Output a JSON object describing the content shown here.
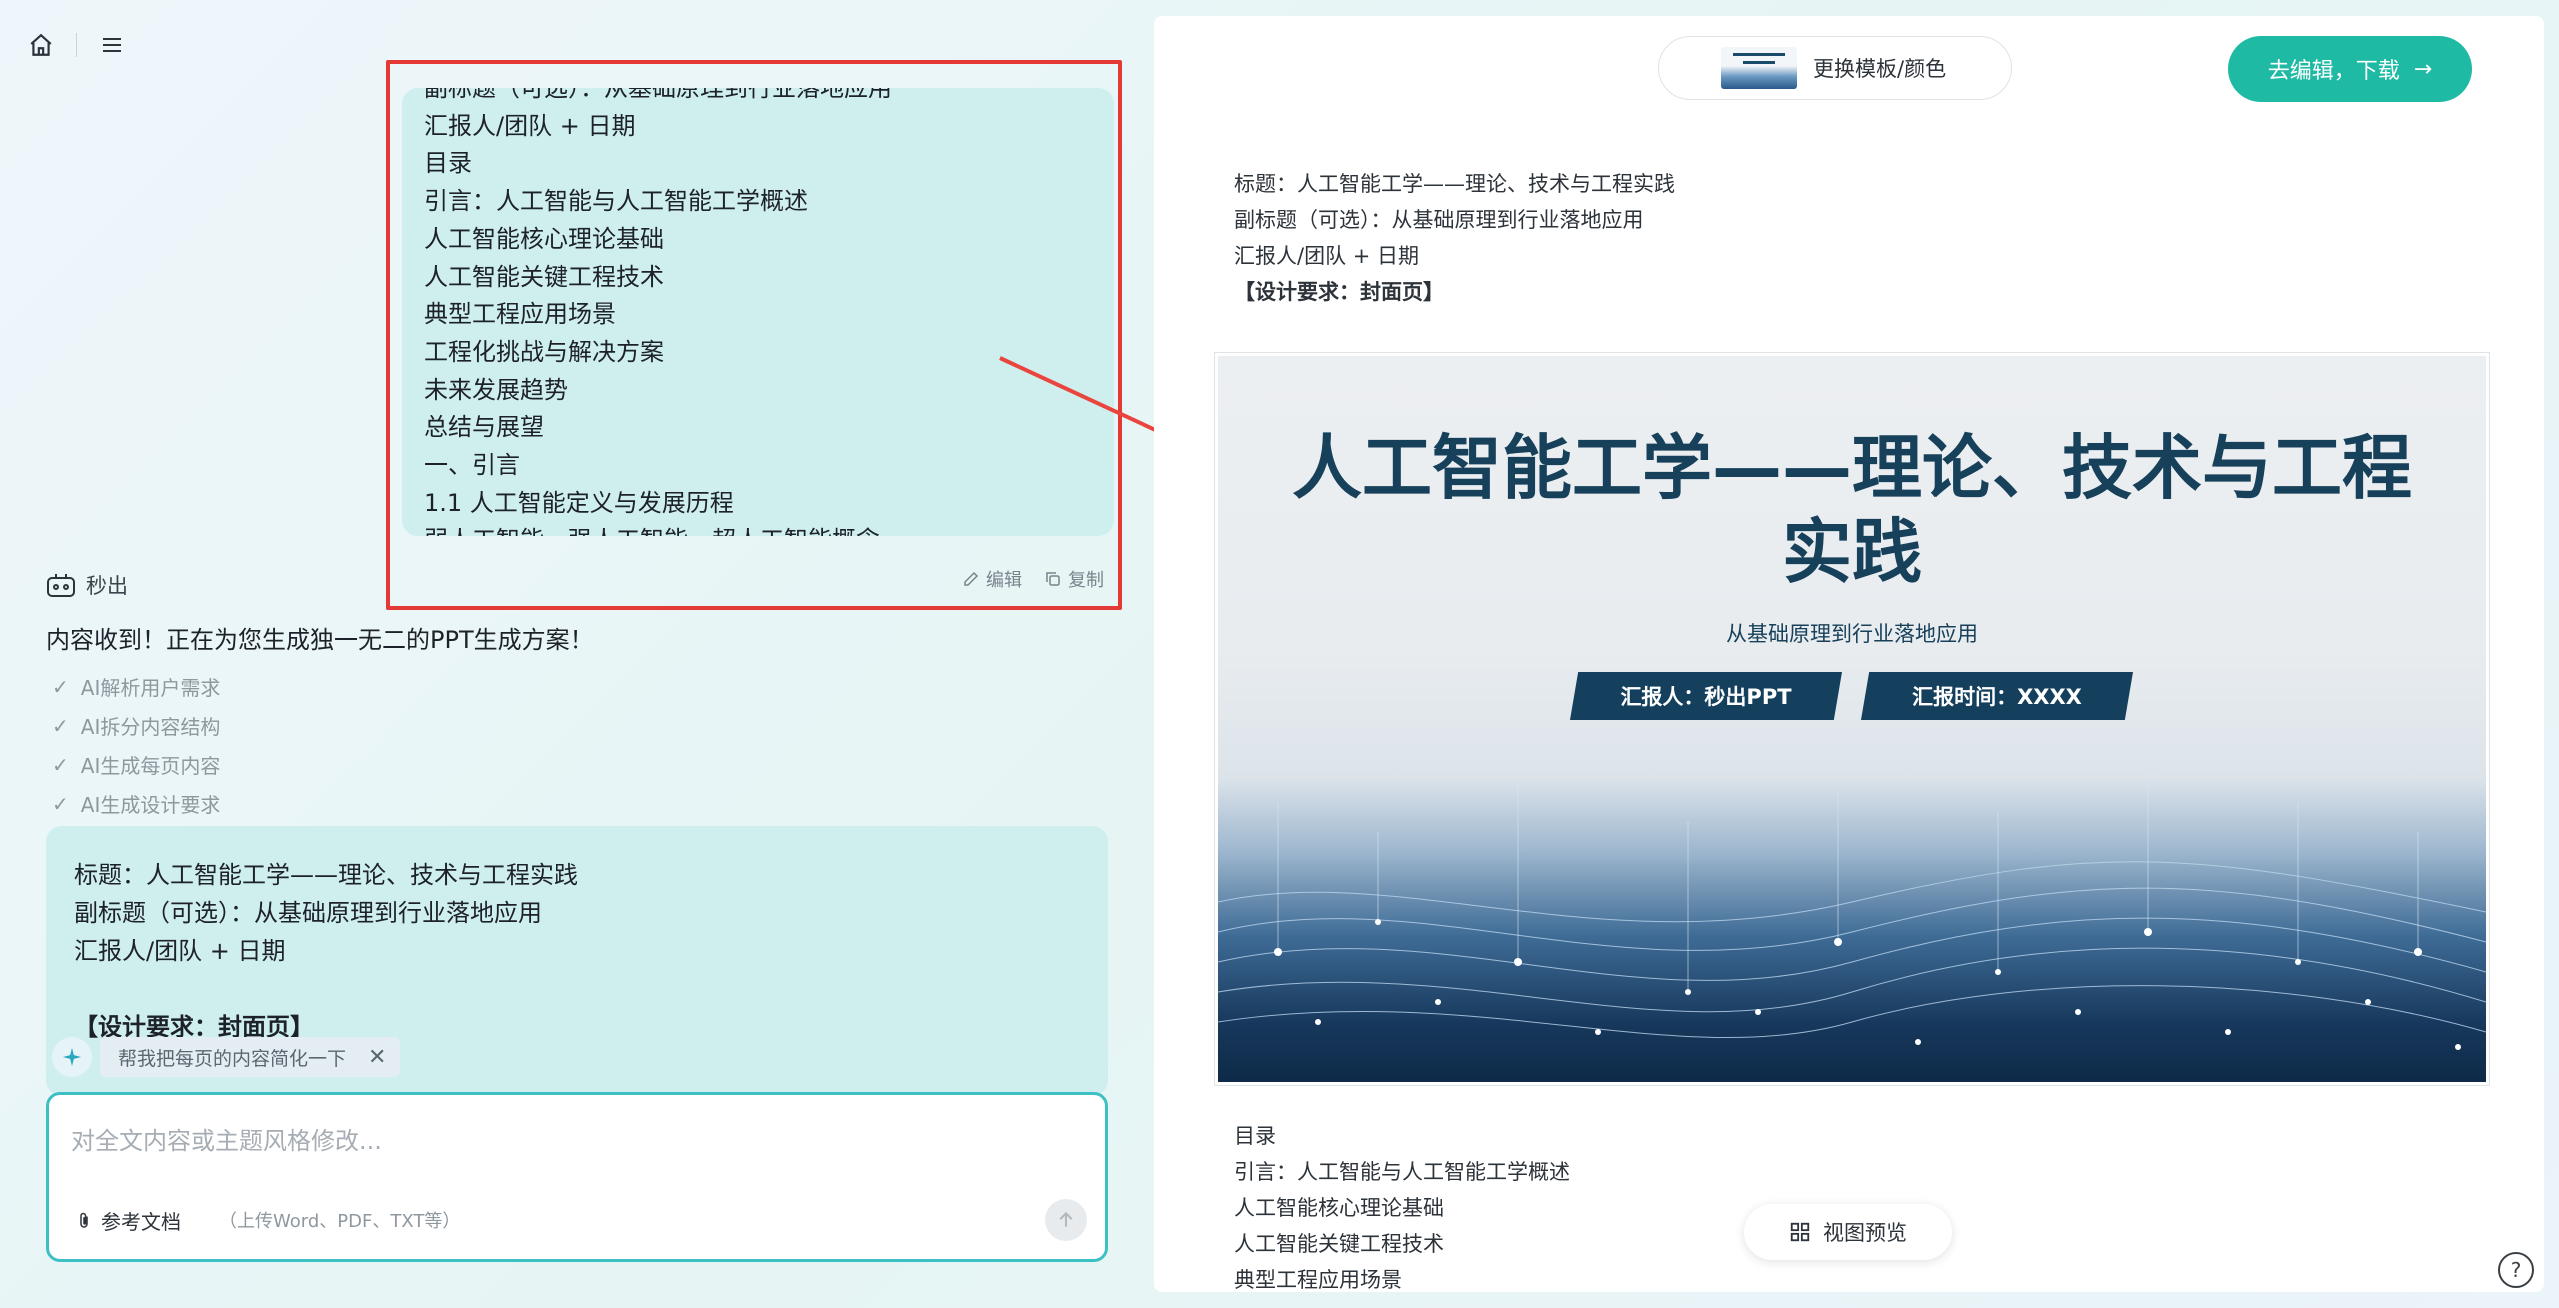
{
  "nav": {
    "home_icon": "home-icon",
    "menu_icon": "menu-icon"
  },
  "user_bubble": {
    "lines": [
      "副标题（可选）：从基础原理到行业落地应用",
      "汇报人/团队 + 日期",
      "目录",
      "引言：人工智能与人工智能工学概述",
      "人工智能核心理论基础",
      "人工智能关键工程技术",
      "典型工程应用场景",
      "工程化挑战与解决方案",
      "未来发展趋势",
      "总结与展望",
      "一、引言",
      "1.1 人工智能定义与发展历程",
      "弱人工智能、强人工智能、超人工智能概念"
    ],
    "edit_label": "编辑",
    "copy_label": "复制"
  },
  "bot": {
    "name": "秒出",
    "message": "内容收到！正在为您生成独一无二的PPT生成方案！",
    "steps": [
      "AI解析用户需求",
      "AI拆分内容结构",
      "AI生成每页内容",
      "AI生成设计要求"
    ]
  },
  "outline_card": {
    "title_line": "标题：人工智能工学——理论、技术与工程实践",
    "subtitle_line": "副标题（可选）：从基础原理到行业落地应用",
    "presenter_line": "汇报人/团队 + 日期",
    "design_line": "【设计要求：封面页】"
  },
  "suggestion": {
    "text": "帮我把每页的内容简化一下"
  },
  "composer": {
    "placeholder": "对全文内容或主题风格修改...",
    "attach_label": "参考文档",
    "attach_hint": "（上传Word、PDF、TXT等）"
  },
  "right_panel": {
    "template_button": "更换模板/颜色",
    "edit_download": "去编辑，下载",
    "page_lines": [
      "标题：人工智能工学——理论、技术与工程实践",
      "副标题（可选）：从基础原理到行业落地应用",
      "汇报人/团队 + 日期"
    ],
    "design_req": "【设计要求：封面页】",
    "slide": {
      "title_line1": "人工智能工学——理论、技术与工程",
      "title_line2": "实践",
      "subtitle": "从基础原理到行业落地应用",
      "tag_presenter": "汇报人：秒出PPT",
      "tag_time": "汇报时间：XXXX"
    },
    "toc_lines": [
      "目录",
      "引言：人工智能与人工智能工学概述",
      "人工智能核心理论基础",
      "人工智能关键工程技术",
      "典型工程应用场景"
    ],
    "view_preview": "视图预览",
    "help": "?"
  },
  "colors": {
    "accent": "#1ebaa3",
    "bubble": "#cfeeee",
    "annotation": "#e53935",
    "slide_title": "#17405a"
  }
}
